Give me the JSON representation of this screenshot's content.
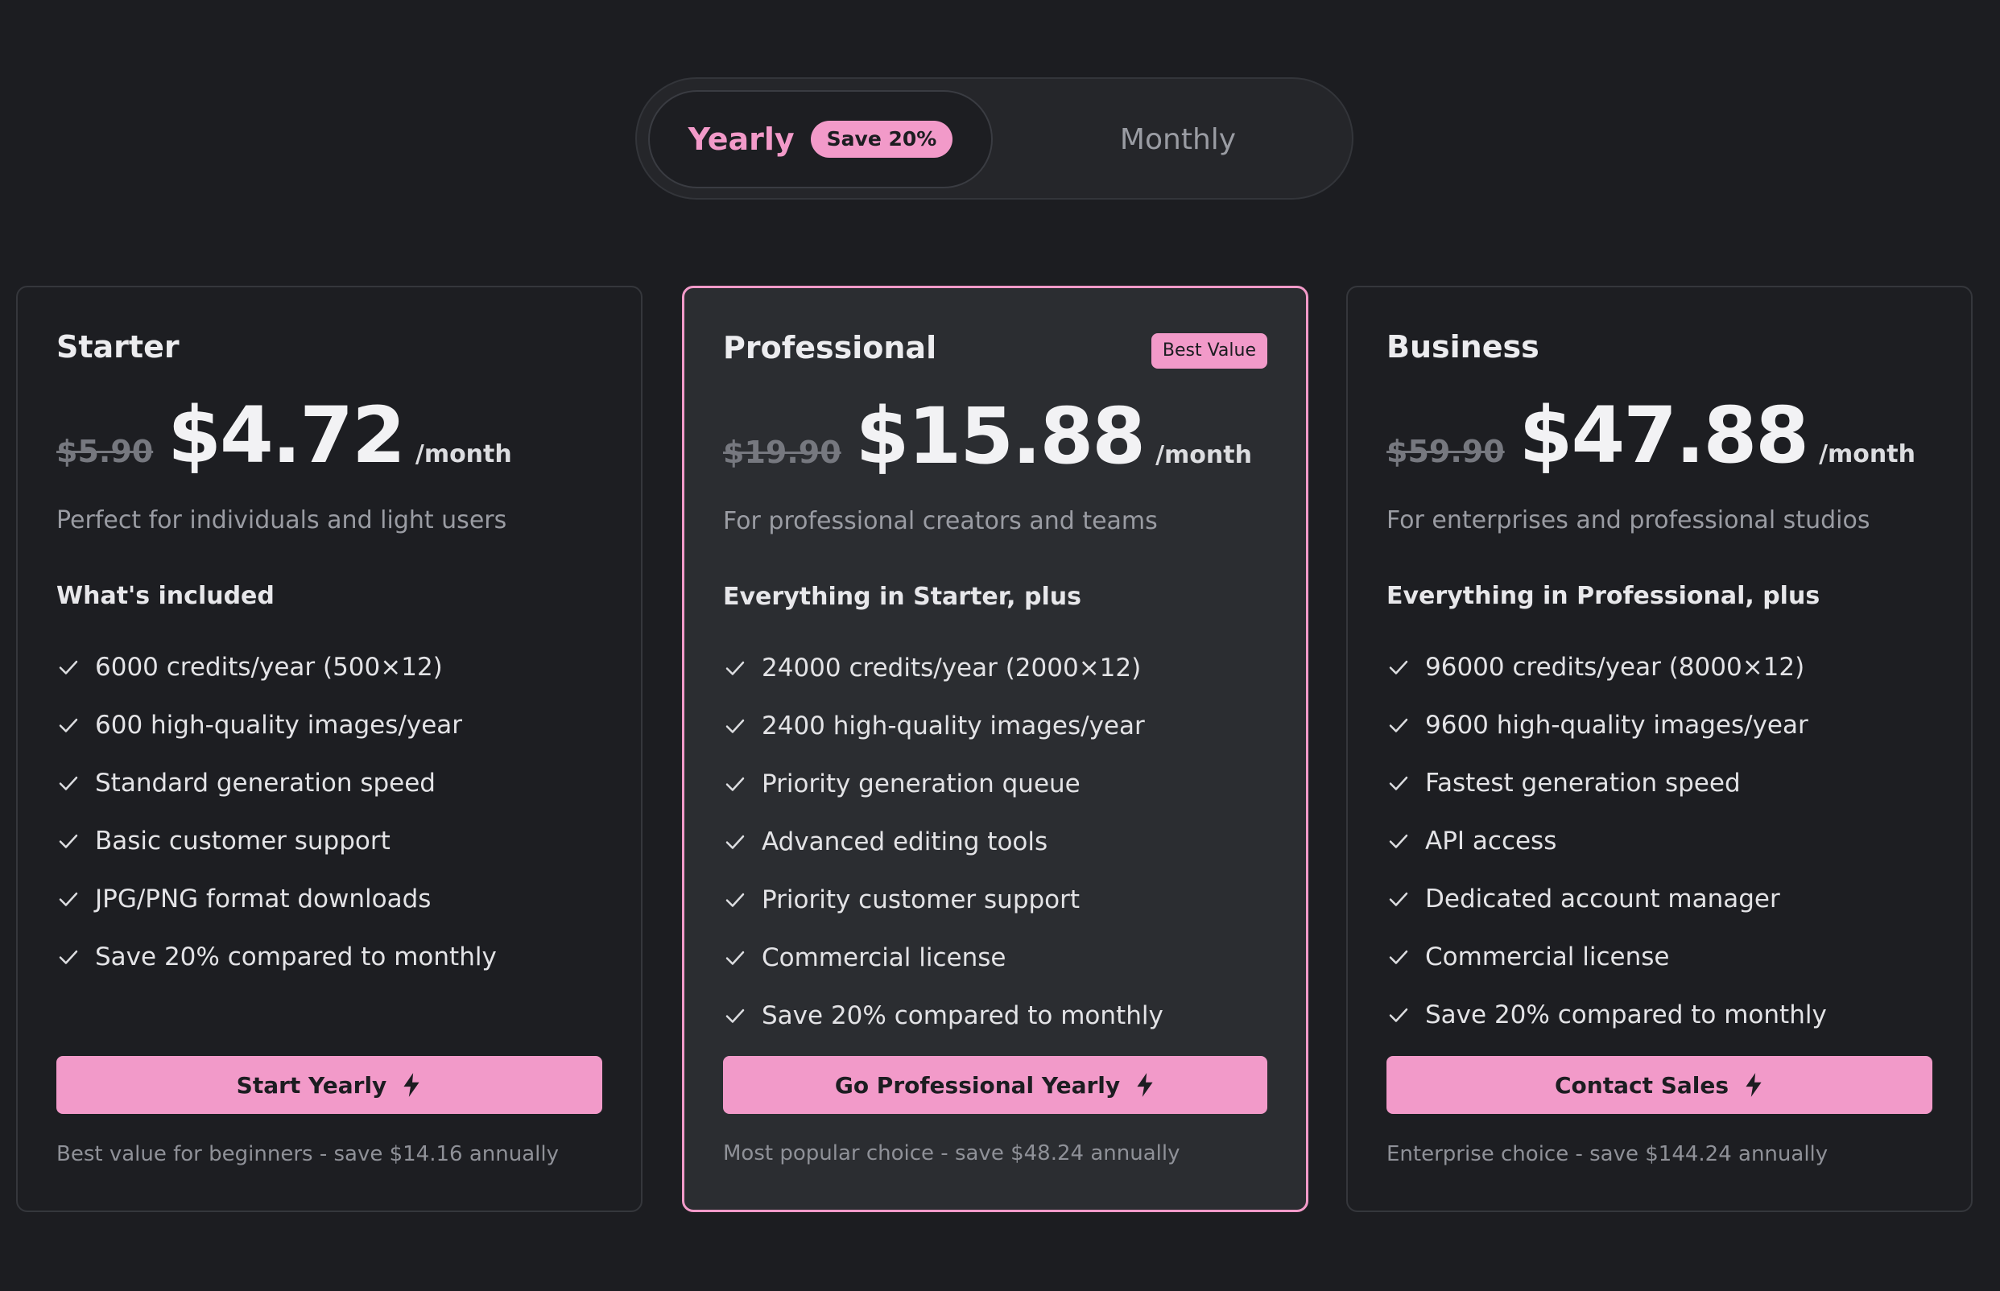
{
  "toggle": {
    "yearly_label": "Yearly",
    "save_badge": "Save 20%",
    "monthly_label": "Monthly",
    "selected": "Yearly"
  },
  "colors": {
    "accent": "#f29ac9",
    "background": "#1c1d21",
    "card": "#1d1e22",
    "featured_card": "#2b2d31"
  },
  "plans": [
    {
      "name": "Starter",
      "old_price": "$5.90",
      "price": "$4.72",
      "per": "/month",
      "description": "Perfect for individuals and light users",
      "included_heading": "What's included",
      "features": [
        "6000 credits/year (500×12)",
        "600 high-quality images/year",
        "Standard generation speed",
        "Basic customer support",
        "JPG/PNG format downloads",
        "Save 20% compared to monthly"
      ],
      "cta": "Start Yearly",
      "footnote": "Best value for beginners - save $14.16 annually"
    },
    {
      "name": "Professional",
      "badge": "Best Value",
      "old_price": "$19.90",
      "price": "$15.88",
      "per": "/month",
      "description": "For professional creators and teams",
      "included_heading": "Everything in Starter, plus",
      "features": [
        "24000 credits/year (2000×12)",
        "2400 high-quality images/year",
        "Priority generation queue",
        "Advanced editing tools",
        "Priority customer support",
        "Commercial license",
        "Save 20% compared to monthly"
      ],
      "cta": "Go Professional Yearly",
      "footnote": "Most popular choice - save $48.24 annually"
    },
    {
      "name": "Business",
      "old_price": "$59.90",
      "price": "$47.88",
      "per": "/month",
      "description": "For enterprises and professional studios",
      "included_heading": "Everything in Professional, plus",
      "features": [
        "96000 credits/year (8000×12)",
        "9600 high-quality images/year",
        "Fastest generation speed",
        "API access",
        "Dedicated account manager",
        "Commercial license",
        "Save 20% compared to monthly"
      ],
      "cta": "Contact Sales",
      "footnote": "Enterprise choice - save $144.24 annually"
    }
  ]
}
